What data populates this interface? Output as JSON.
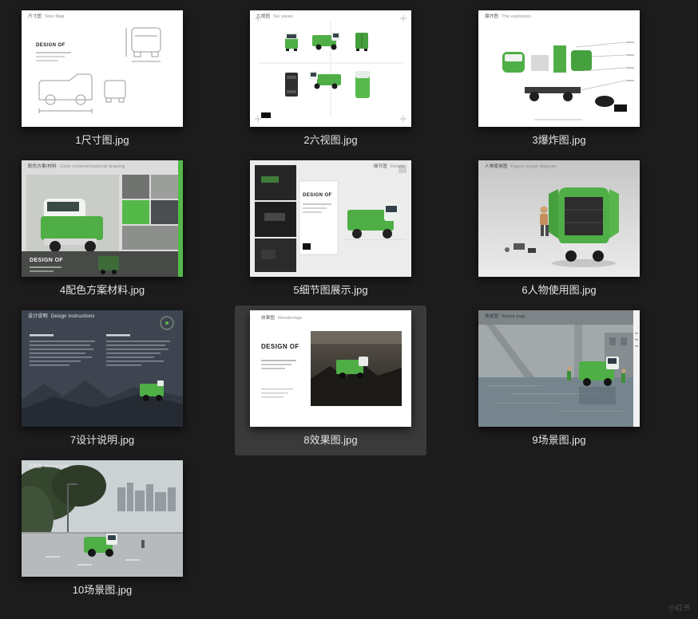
{
  "window": {
    "background": "#1c1c1c",
    "watermark": "小红书"
  },
  "gallery": {
    "selected_file": "8效果图.jpg",
    "items": [
      {
        "filename": "1尺寸图.jpg",
        "title_zh": "尺寸图",
        "title_en": "Size Map",
        "design_of": "DESIGN OF"
      },
      {
        "filename": "2六视图.jpg",
        "title_zh": "六视图",
        "title_en": "Six views"
      },
      {
        "filename": "3爆炸图.jpg",
        "title_zh": "爆炸图",
        "title_en": "The explosion"
      },
      {
        "filename": "4配色方案材料.jpg",
        "title_zh": "配色方案/材料",
        "title_en": "Color scheme/material drawing",
        "design_of": "DESIGN OF"
      },
      {
        "filename": "5细节图展示.jpg",
        "title_zh": "细节图",
        "title_en": "Details",
        "design_of": "DESIGN OF"
      },
      {
        "filename": "6人物使用图.jpg",
        "title_zh": "人物使用图",
        "title_en": "Figure usage diagram"
      },
      {
        "filename": "7设计说明.jpg",
        "title_zh": "设计说明",
        "title_en": "Design Instructions"
      },
      {
        "filename": "8效果图.jpg",
        "title_zh": "效果图",
        "title_en": "Renderings",
        "design_of": "DESIGN OF"
      },
      {
        "filename": "9场景图.jpg",
        "title_zh": "场景图",
        "title_en": "Scene map"
      },
      {
        "filename": "10场景图.jpg",
        "title_zh": "场景图",
        "title_en": "Scene map"
      }
    ]
  },
  "colors": {
    "accent_green": "#4fae46",
    "selected_bg": "#3a3a3a",
    "caption_text": "#e6e6e6"
  }
}
